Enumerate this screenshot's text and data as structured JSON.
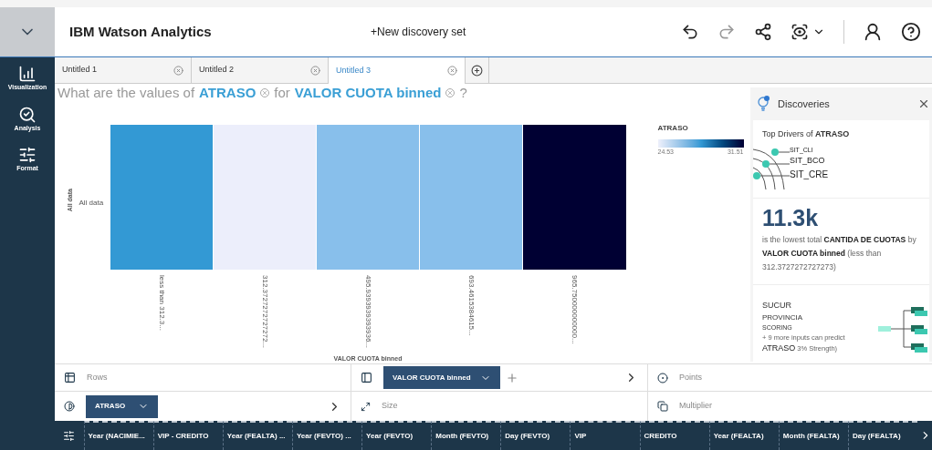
{
  "header": {
    "title": "IBM Watson Analytics",
    "new_set": "+New discovery set"
  },
  "side_nav": [
    {
      "kind": "visualization",
      "label": "Visualization"
    },
    {
      "kind": "analysis",
      "label": "Analysis"
    },
    {
      "kind": "format",
      "label": "Format"
    }
  ],
  "tabs": [
    {
      "label": "Untitled 1",
      "selected": false
    },
    {
      "label": "Untitled 2",
      "selected": false
    },
    {
      "label": "Untitled 3",
      "selected": true
    }
  ],
  "question": {
    "prefix": "What are the values of",
    "measure": "ATRASO",
    "joiner": "for",
    "dimension": "VALOR CUOTA binned",
    "suffix": "?"
  },
  "heatmap": {
    "y_title": "All data",
    "row_label": "All data",
    "x_title": "VALOR CUOTA binned",
    "cells": [
      {
        "label": "less than 312.3...",
        "color": "#3399d4"
      },
      {
        "label": "312.3727272727272...",
        "color": "#eceefb"
      },
      {
        "label": "495.9393939393936...",
        "color": "#88bfeb"
      },
      {
        "label": "693.4615384615...",
        "color": "#88bfeb"
      },
      {
        "label": "965.750000000000...",
        "color": "#000033"
      }
    ],
    "legend": {
      "title": "ATRASO",
      "min": "24.53",
      "max": "31.51"
    }
  },
  "discoveries": {
    "title": "Discoveries",
    "drivers_title": "Top Drivers of **ATRASO**",
    "drivers": [
      "SIT_CLI",
      "SIT_BCO",
      "SIT_CRE"
    ],
    "stat": "11.3k",
    "stat_text": "is the lowest total **CANTIDA DE CUOTAS** by **VALOR CUOTA binned** (less than 312.3727272727273)",
    "inputs": [
      "SUCUR",
      "PROVINCIA",
      "SCORING"
    ],
    "more": "+ 9 more inputs can predict",
    "target": "ATRASO",
    "strength": "3% Strength)"
  },
  "shelves": {
    "rows": "Rows",
    "columns_chip": "VALOR CUOTA binned",
    "points": "Points",
    "color_chip": "ATRASO",
    "size": "Size",
    "multiplier": "Multiplier"
  },
  "fields": [
    "Year (NACIMIE...",
    "VIP - CREDITO",
    "Year (FEALTA) ...",
    "Year (FEVTO) ...",
    "Year (FEVTO)",
    "Month (FEVTO)",
    "Day (FEVTO)",
    "VIP",
    "CREDITO",
    "Year (FEALTA)",
    "Month (FEALTA)",
    "Day (FEALTA)"
  ]
}
